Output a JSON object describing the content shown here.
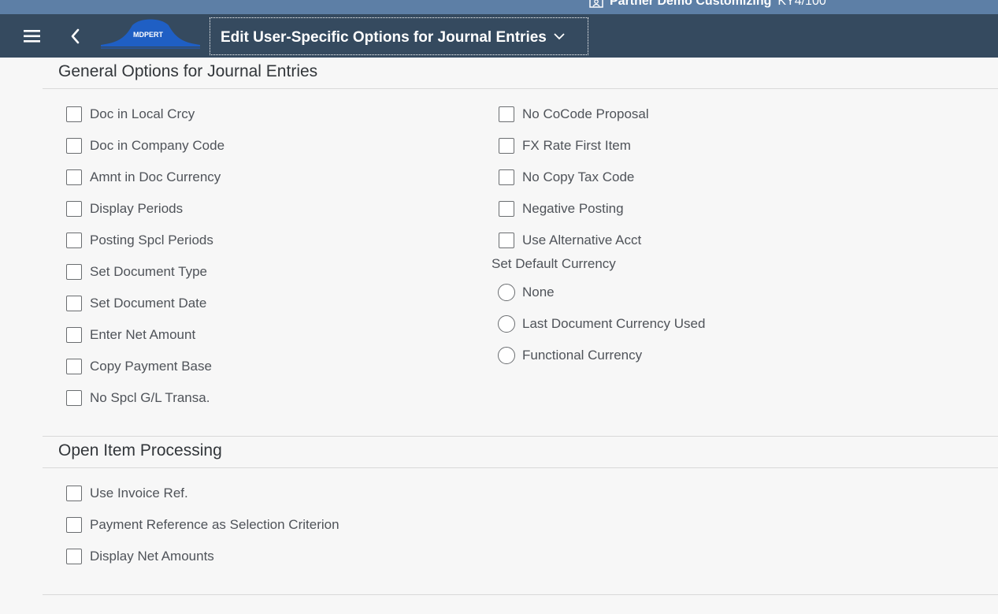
{
  "system": {
    "name": "Partner Demo Customizing",
    "client": "KY4/100"
  },
  "shell": {
    "logo_text": "MDPERT",
    "title": "Edit User-Specific Options for Journal Entries"
  },
  "sections": {
    "general": {
      "title": "General Options for Journal Entries",
      "left_checkboxes": [
        {
          "label": "Doc in Local Crcy",
          "checked": false
        },
        {
          "label": "Doc in Company Code",
          "checked": false
        },
        {
          "label": "Amnt in Doc Currency",
          "checked": false
        },
        {
          "label": "Display Periods",
          "checked": false
        },
        {
          "label": "Posting Spcl Periods",
          "checked": false
        },
        {
          "label": "Set Document Type",
          "checked": false
        },
        {
          "label": "Set Document Date",
          "checked": false
        },
        {
          "label": "Enter Net Amount",
          "checked": false
        },
        {
          "label": "Copy Payment Base",
          "checked": false
        },
        {
          "label": "No Spcl G/L Transa.",
          "checked": false
        }
      ],
      "right_checkboxes": [
        {
          "label": "No CoCode Proposal",
          "checked": false
        },
        {
          "label": "FX Rate First Item",
          "checked": false
        },
        {
          "label": "No Copy Tax Code",
          "checked": false
        },
        {
          "label": "Negative Posting",
          "checked": false
        },
        {
          "label": "Use Alternative Acct",
          "checked": false
        }
      ],
      "default_currency": {
        "label": "Set Default Currency",
        "options": [
          {
            "label": "None",
            "selected": false
          },
          {
            "label": "Last Document Currency Used",
            "selected": false
          },
          {
            "label": "Functional Currency",
            "selected": false
          }
        ]
      }
    },
    "open_items": {
      "title": "Open Item Processing",
      "checkboxes": [
        {
          "label": "Use Invoice Ref.",
          "checked": false
        },
        {
          "label": "Payment Reference as Selection Criterion",
          "checked": false
        },
        {
          "label": "Display Net Amounts",
          "checked": false
        }
      ]
    }
  },
  "colors": {
    "shell_bg": "#354a5f",
    "top_strip_bg": "#5d7fa6",
    "page_bg": "#f7f7f7",
    "logo_blue": "#1f5fc4"
  }
}
